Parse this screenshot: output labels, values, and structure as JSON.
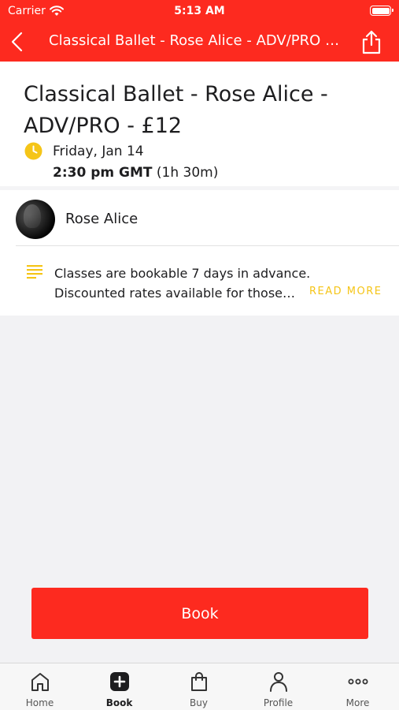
{
  "status_bar": {
    "carrier": "Carrier",
    "time": "5:13 AM"
  },
  "nav": {
    "title": "Classical Ballet - Rose Alice - ADV/PRO - £12",
    "color": "#fd2a1f"
  },
  "event": {
    "title": "Classical Ballet - Rose Alice - ADV/PRO - £12",
    "date": "Friday, Jan 14",
    "time": "2:30 pm GMT",
    "duration": "(1h 30m)"
  },
  "instructor": {
    "name": "Rose Alice"
  },
  "description": {
    "line1": "Classes are bookable 7 days in advance.",
    "line2": "Discounted rates available for those…",
    "read_more": "READ MORE",
    "accent_color": "#f5c518"
  },
  "book_button": {
    "label": "Book"
  },
  "tab_bar": {
    "items": [
      {
        "label": "Home",
        "icon": "home-icon"
      },
      {
        "label": "Book",
        "icon": "plus-square-icon",
        "active": true
      },
      {
        "label": "Buy",
        "icon": "shopping-bag-icon"
      },
      {
        "label": "Profile",
        "icon": "person-icon"
      },
      {
        "label": "More",
        "icon": "more-dots-icon"
      }
    ]
  }
}
